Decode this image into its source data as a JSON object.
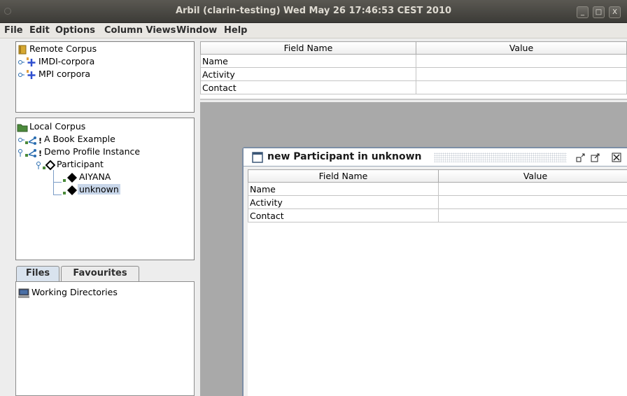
{
  "window": {
    "title": "Arbil (clarin-testing) Wed May 26 17:46:53 CEST 2010",
    "buttons": [
      "_",
      "□",
      "X"
    ]
  },
  "menubar": [
    "File",
    "Edit",
    "Options",
    "Column Views",
    "Window",
    "Help"
  ],
  "remote_tree": {
    "root": "Remote Corpus",
    "children": [
      "IMDI-corpora",
      "MPI corpora"
    ]
  },
  "top_table": {
    "headers": [
      "Field Name",
      "Value"
    ],
    "rows": [
      [
        "Name",
        ""
      ],
      [
        "Activity",
        ""
      ],
      [
        "Contact",
        ""
      ]
    ]
  },
  "local_tree": {
    "root": "Local Corpus",
    "items": [
      "A Book Example",
      "Demo Profile Instance",
      "Participant",
      "AIYANA",
      "unknown"
    ],
    "selected": "unknown"
  },
  "tabs": [
    "Files",
    "Favourites"
  ],
  "files_tree": [
    "Working Directories"
  ],
  "inner_frame": {
    "title": "new Participant in unknown",
    "headers": [
      "Field Name",
      "Value"
    ],
    "rows": [
      [
        "Name",
        ""
      ],
      [
        "Activity",
        ""
      ],
      [
        "Contact",
        ""
      ]
    ]
  }
}
